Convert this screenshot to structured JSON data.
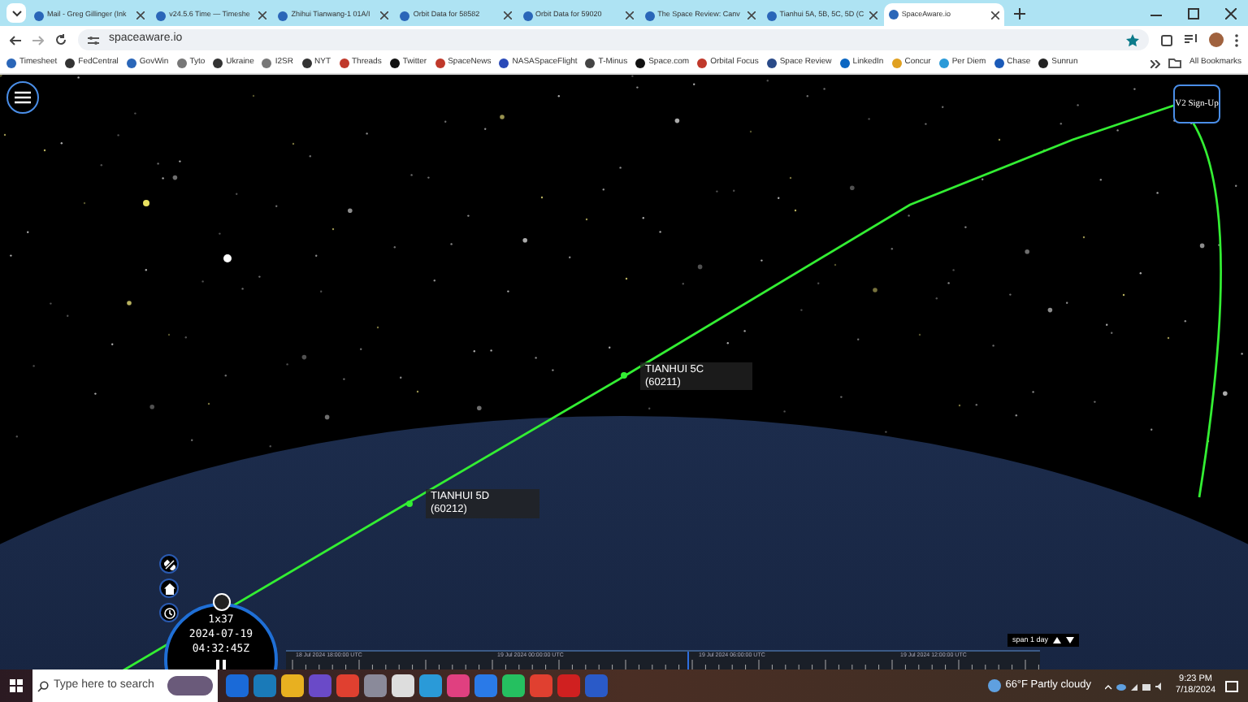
{
  "tabs": [
    {
      "label": "Mail - Greg Gillinger (Ink",
      "selected": false
    },
    {
      "label": "v24.5.6 Time — Timeshe",
      "selected": false
    },
    {
      "label": "Zhihui Tianwang-1 01A/I",
      "selected": false
    },
    {
      "label": "Orbit Data for 58582",
      "selected": false
    },
    {
      "label": "Orbit Data for 59020",
      "selected": false
    },
    {
      "label": "The Space Review: Canv",
      "selected": false
    },
    {
      "label": "Tianhui 5A, 5B, 5C, 5D (C",
      "selected": false
    },
    {
      "label": "SpaceAware.io",
      "selected": true
    }
  ],
  "address": "spaceaware.io",
  "bookmarks": [
    "Timesheet",
    "FedCentral",
    "GovWin",
    "Tyto",
    "Ukraine",
    "I2SR",
    "NYT",
    "Threads",
    "Twitter",
    "SpaceNews",
    "NASASpaceFlight",
    "T-Minus",
    "Space.com",
    "Orbital Focus",
    "Space Review",
    "LinkedIn",
    "Concur",
    "Per Diem",
    "Chase",
    "Sunrun"
  ],
  "all_bookmarks": "All Bookmarks",
  "signup_button": "V2 Sign-Up",
  "satellites": [
    {
      "name": "TIANHUI 5C",
      "id": "(60211)"
    },
    {
      "name": "TIANHUI 5D",
      "id": "(60212)"
    }
  ],
  "clock": {
    "speed": "1x37",
    "date": "2024-07-19",
    "time": "04:32:45Z"
  },
  "timeline": {
    "labels": [
      "18 Jul 2024 18:00:00 UTC",
      "19 Jul 2024 00:00:00 UTC",
      "19 Jul 2024 06:00:00 UTC",
      "19 Jul 2024 12:00:00 UTC"
    ],
    "span": "span 1 day"
  },
  "taskbar": {
    "search_placeholder": "Type here to search",
    "weather": "66°F  Partly cloudy",
    "time": "9:23 PM",
    "date": "7/18/2024"
  }
}
